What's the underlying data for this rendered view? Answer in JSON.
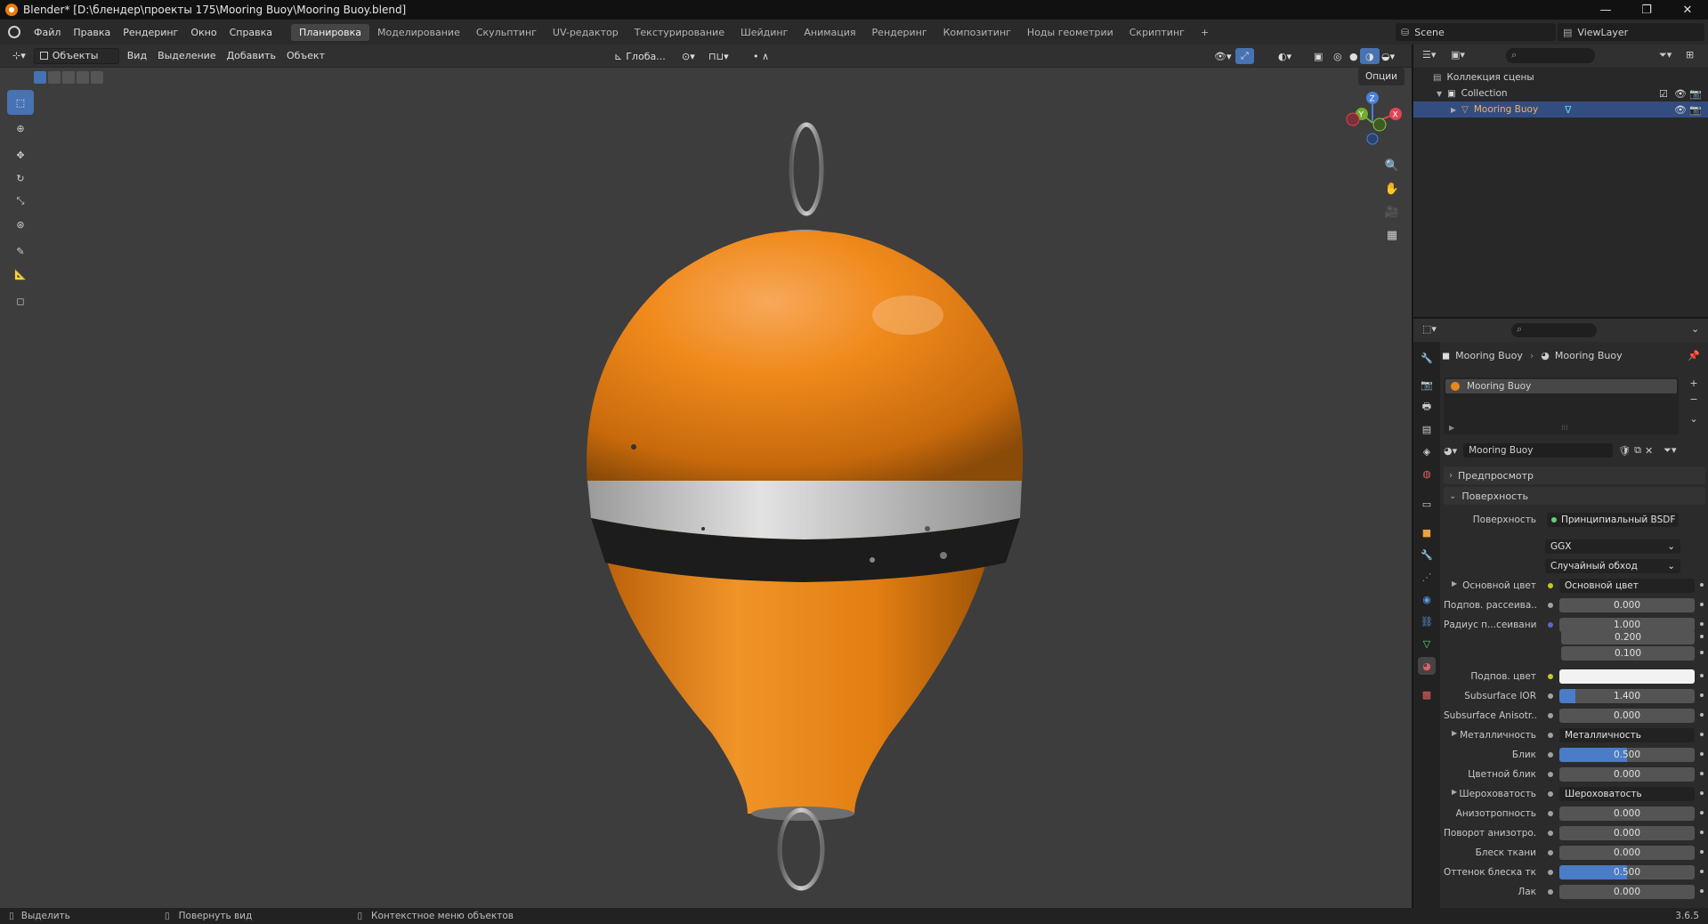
{
  "window": {
    "title": "Blender* [D:\\блендер\\проекты 175\\Mooring Buoy\\Mooring Buoy.blend]",
    "minimize": "—",
    "maximize": "❐",
    "close": "✕"
  },
  "menu": {
    "items": [
      "Файл",
      "Правка",
      "Рендеринг",
      "Окно",
      "Справка"
    ],
    "workspaces": [
      "Планировка",
      "Моделирование",
      "Скульптинг",
      "UV-редактор",
      "Текстурирование",
      "Шейдинг",
      "Анимация",
      "Рендеринг",
      "Композитинг",
      "Ноды геометрии",
      "Скриптинг"
    ],
    "active_workspace": "Планировка",
    "add_tab": "+",
    "scene": "Scene",
    "view_layer": "ViewLayer"
  },
  "viewport_header": {
    "mode": "Объекты",
    "menus": [
      "Вид",
      "Выделение",
      "Добавить",
      "Объект"
    ],
    "orientation": "Глоба...",
    "options": "Опции"
  },
  "gizmo": {
    "z": "Z",
    "y": "Y",
    "x": "X"
  },
  "outliner": {
    "root": "Коллекция сцены",
    "collection": "Collection",
    "object": "Mooring Buoy"
  },
  "properties": {
    "breadcrumb_object": "Mooring Buoy",
    "breadcrumb_material": "Mooring Buoy",
    "slot_name": "Mooring Buoy",
    "material_name": "Mooring Buoy",
    "preview_section": "Предпросмотр",
    "surface_section": "Поверхность",
    "surface_label": "Поверхность",
    "surface_value": "Принципиальный BSDF",
    "distribution": "GGX",
    "subsurface_method": "Случайный обход",
    "rows": [
      {
        "label": "Основной цвет",
        "value": "Основной цвет",
        "kind": "link",
        "sock": "#c7c729",
        "expand": true
      },
      {
        "label": "Подпов. рассеива...",
        "value": "0.000",
        "kind": "num",
        "sock": "#a1a1a1"
      },
      {
        "label": "Радиус п...сеивания",
        "value": "1.000",
        "kind": "num",
        "sock": "#6363c7"
      },
      {
        "label": "",
        "value": "0.200",
        "kind": "num",
        "sock": ""
      },
      {
        "label": "",
        "value": "0.100",
        "kind": "num",
        "sock": ""
      },
      {
        "label": "Подпов. цвет",
        "value": "",
        "kind": "color",
        "sock": "#c7c729"
      },
      {
        "label": "Subsurface IOR",
        "value": "1.400",
        "kind": "slider",
        "pct": 0.12,
        "sock": "#a1a1a1"
      },
      {
        "label": "Subsurface Anisotr...",
        "value": "0.000",
        "kind": "num",
        "sock": "#a1a1a1"
      },
      {
        "label": "Металличность",
        "value": "Металличность",
        "kind": "link",
        "sock": "#a1a1a1",
        "expand": true
      },
      {
        "label": "Блик",
        "value": "0.500",
        "kind": "slider",
        "pct": 0.5,
        "sock": "#a1a1a1"
      },
      {
        "label": "Цветной блик",
        "value": "0.000",
        "kind": "num",
        "sock": "#a1a1a1"
      },
      {
        "label": "Шероховатость",
        "value": "Шероховатость",
        "kind": "link",
        "sock": "#a1a1a1",
        "expand": true
      },
      {
        "label": "Анизотропность",
        "value": "0.000",
        "kind": "num",
        "sock": "#a1a1a1"
      },
      {
        "label": "Поворот анизотро...",
        "value": "0.000",
        "kind": "num",
        "sock": "#a1a1a1"
      },
      {
        "label": "Блеск ткани",
        "value": "0.000",
        "kind": "num",
        "sock": "#a1a1a1"
      },
      {
        "label": "Оттенок блеска тк...",
        "value": "0.500",
        "kind": "slider",
        "pct": 0.5,
        "sock": "#a1a1a1"
      },
      {
        "label": "Лак",
        "value": "0.000",
        "kind": "num",
        "sock": "#a1a1a1"
      }
    ]
  },
  "status": {
    "select": "Выделить",
    "rotate": "Повернуть вид",
    "context": "Контекстное меню объектов",
    "version": "3.6.5"
  },
  "colors": {
    "accent": "#4772b3",
    "buoy_orange": "#f08a1c",
    "band_white": "#d8d8d8",
    "band_black": "#1a1a1a"
  }
}
